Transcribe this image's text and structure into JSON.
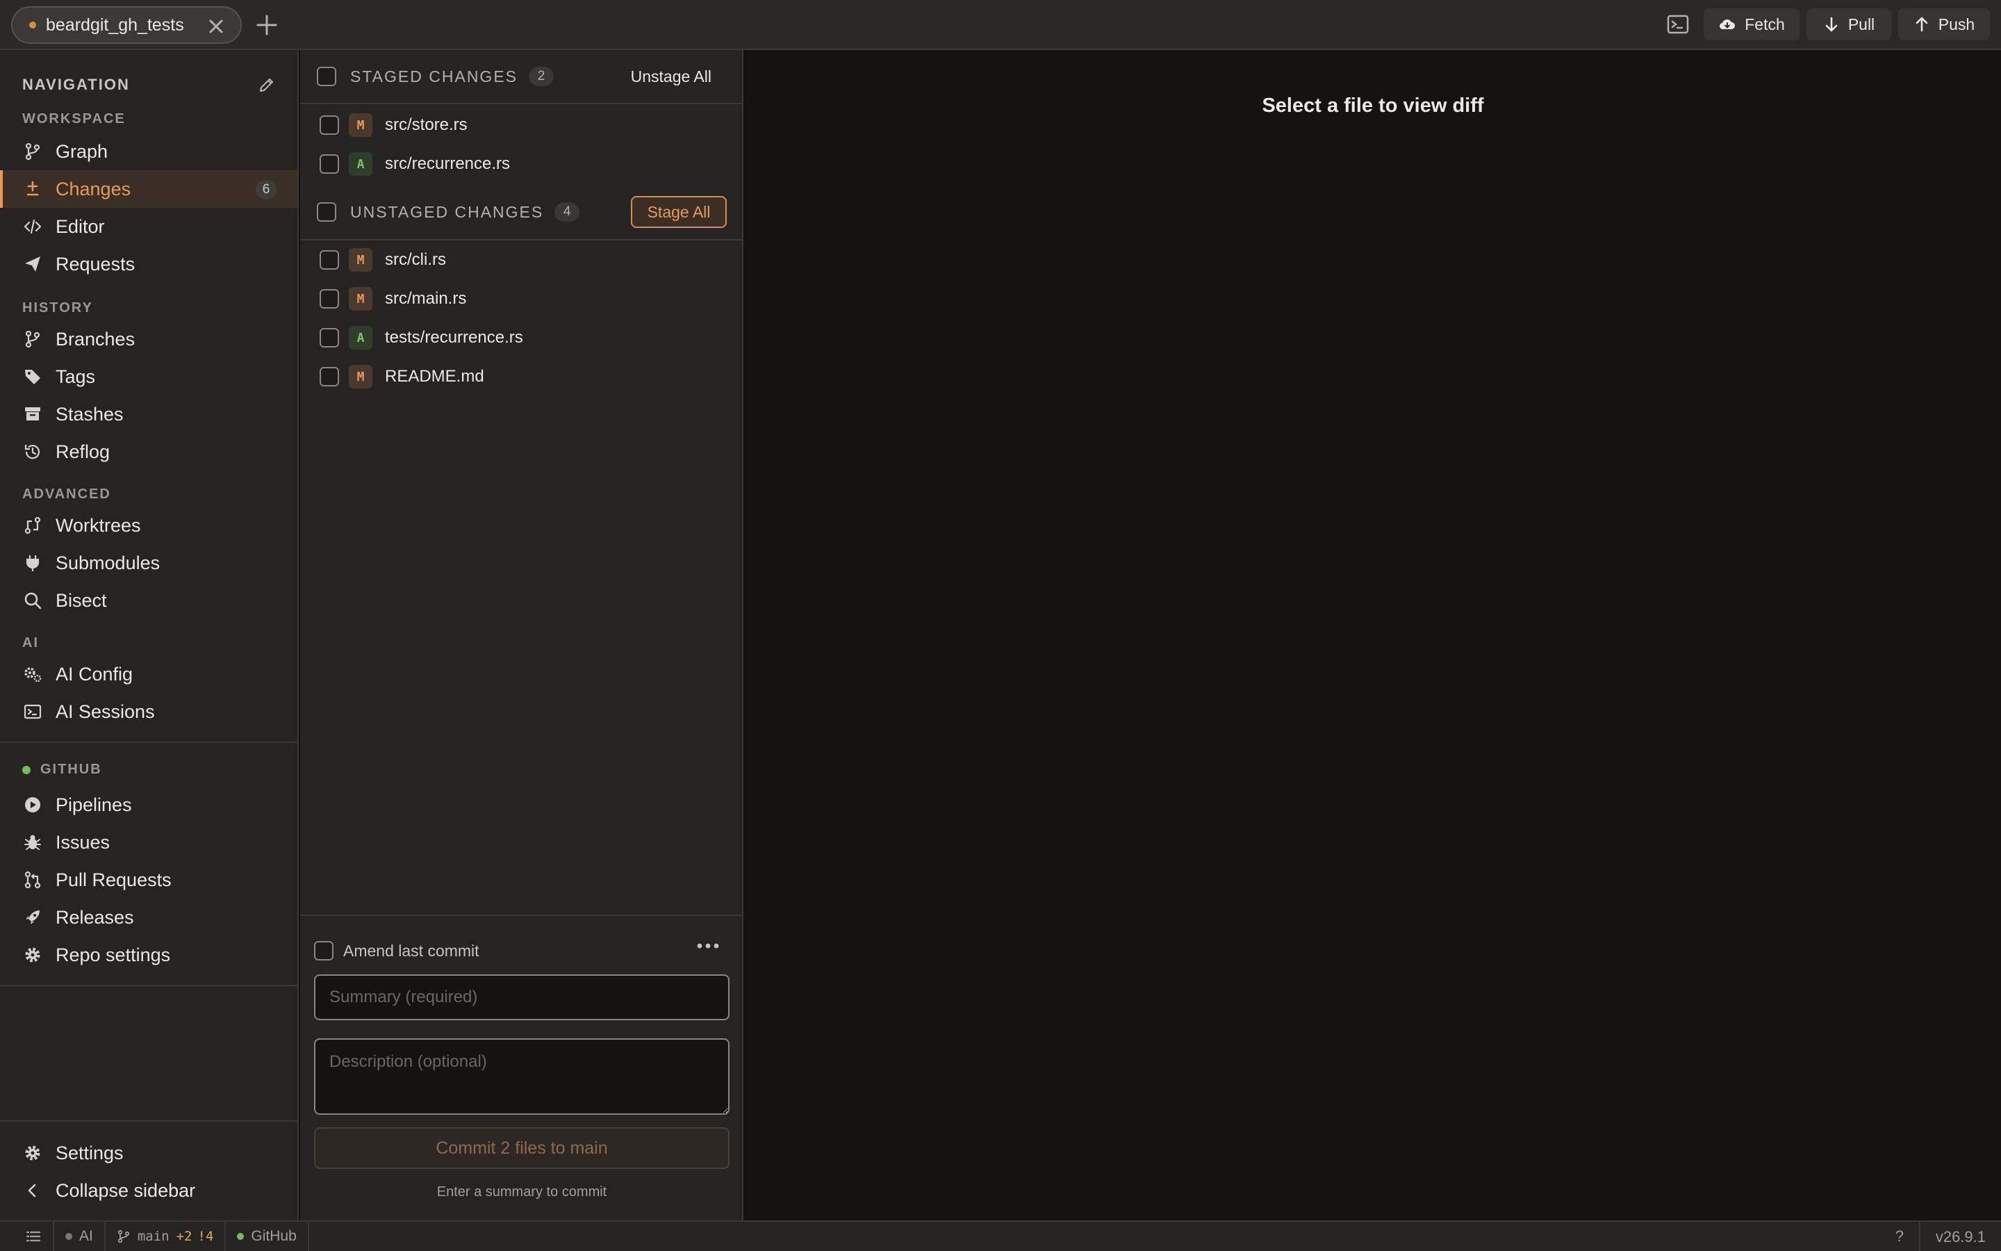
{
  "topbar": {
    "tab_title": "beardgit_gh_tests",
    "fetch_label": "Fetch",
    "pull_label": "Pull",
    "push_label": "Push"
  },
  "sidebar": {
    "header": "NAVIGATION",
    "sections": {
      "workspace": "WORKSPACE",
      "history": "HISTORY",
      "advanced": "ADVANCED",
      "ai": "AI",
      "github": "GITHUB"
    },
    "items": {
      "graph": "Graph",
      "changes": "Changes",
      "changes_count": "6",
      "editor": "Editor",
      "requests": "Requests",
      "branches": "Branches",
      "tags": "Tags",
      "stashes": "Stashes",
      "reflog": "Reflog",
      "worktrees": "Worktrees",
      "submodules": "Submodules",
      "bisect": "Bisect",
      "ai_config": "AI Config",
      "ai_sessions": "AI Sessions",
      "pipelines": "Pipelines",
      "issues": "Issues",
      "pull_requests": "Pull Requests",
      "releases": "Releases",
      "repo_settings": "Repo settings",
      "settings": "Settings",
      "collapse": "Collapse sidebar"
    },
    "github_status_color": "#6fbf5a"
  },
  "changes": {
    "staged": {
      "title": "STAGED CHANGES",
      "count": "2",
      "action": "Unstage All",
      "files": [
        {
          "status": "M",
          "name": "src/store.rs"
        },
        {
          "status": "A",
          "name": "src/recurrence.rs"
        }
      ]
    },
    "unstaged": {
      "title": "UNSTAGED CHANGES",
      "count": "4",
      "action": "Stage All",
      "files": [
        {
          "status": "M",
          "name": "src/cli.rs"
        },
        {
          "status": "M",
          "name": "src/main.rs"
        },
        {
          "status": "A",
          "name": "tests/recurrence.rs"
        },
        {
          "status": "M",
          "name": "README.md"
        }
      ]
    },
    "commit": {
      "amend_label": "Amend last commit",
      "summary_placeholder": "Summary (required)",
      "description_placeholder": "Description (optional)",
      "commit_label": "Commit 2 files to main",
      "hint": "Enter a summary to commit"
    }
  },
  "diff": {
    "empty_message": "Select a file to view diff"
  },
  "statusbar": {
    "ai_label": "AI",
    "branch": "main",
    "ahead": "+2",
    "dirty": "!4",
    "github_label": "GitHub",
    "help": "?",
    "version": "v26.9.1"
  },
  "colors": {
    "accent": "#e69a5a",
    "modified": "#e69a5a",
    "added": "#7fc26a",
    "background": "#141312",
    "panel": "#252423"
  }
}
